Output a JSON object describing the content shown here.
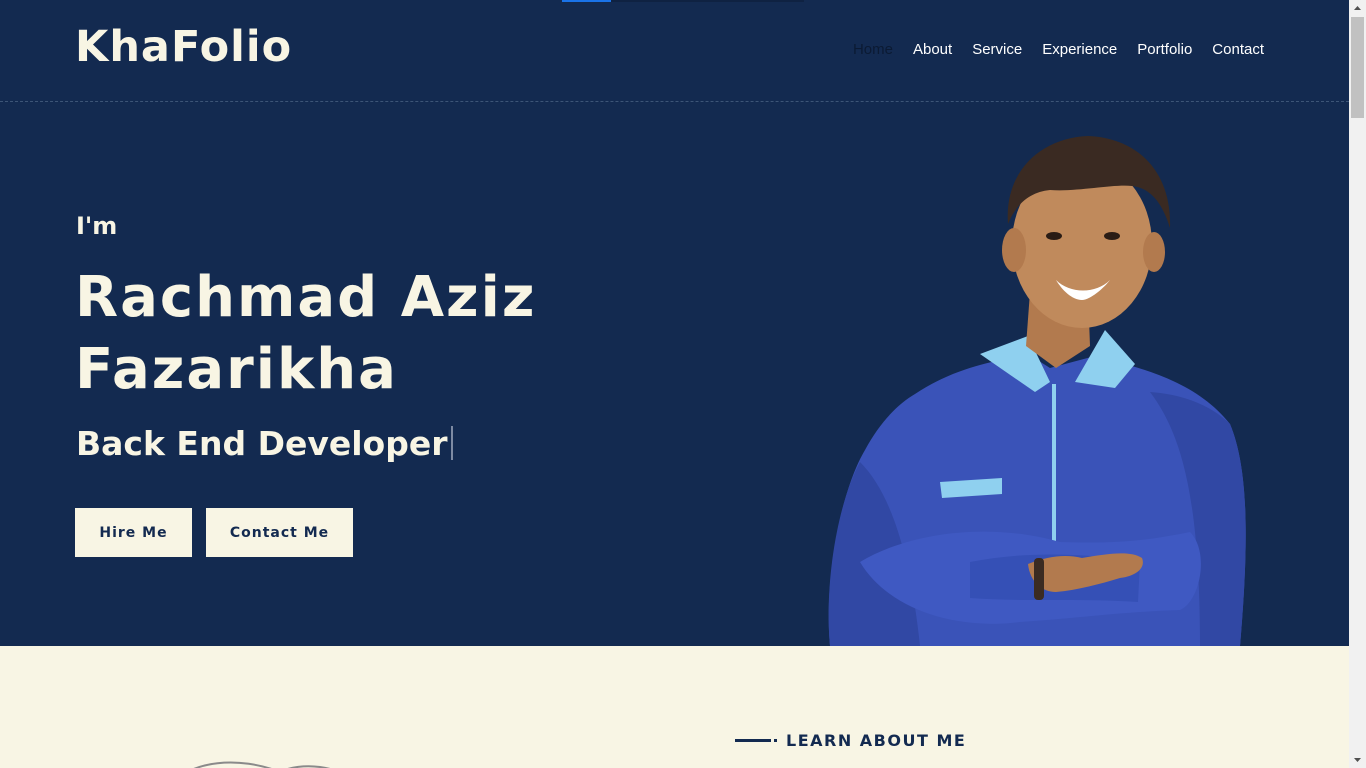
{
  "brand": {
    "logo": "KhaFolio"
  },
  "nav": {
    "items": [
      {
        "label": "Home",
        "active": true
      },
      {
        "label": "About",
        "active": false
      },
      {
        "label": "Service",
        "active": false
      },
      {
        "label": "Experience",
        "active": false
      },
      {
        "label": "Portfolio",
        "active": false
      },
      {
        "label": "Contact",
        "active": false
      }
    ]
  },
  "hero": {
    "intro": "I'm",
    "name_line1": "Rachmad Aziz",
    "name_line2": "Fazarikha",
    "role": "Back End Developer",
    "hire_button": "Hire Me",
    "contact_button": "Contact Me",
    "portrait_icon": "person-portrait"
  },
  "about": {
    "section_label": "LEARN ABOUT ME"
  },
  "colors": {
    "hero_bg": "#132a50",
    "cream": "#f8f5e4",
    "nav_active": "#0b1a33",
    "loader_accent": "#1a73e8"
  }
}
